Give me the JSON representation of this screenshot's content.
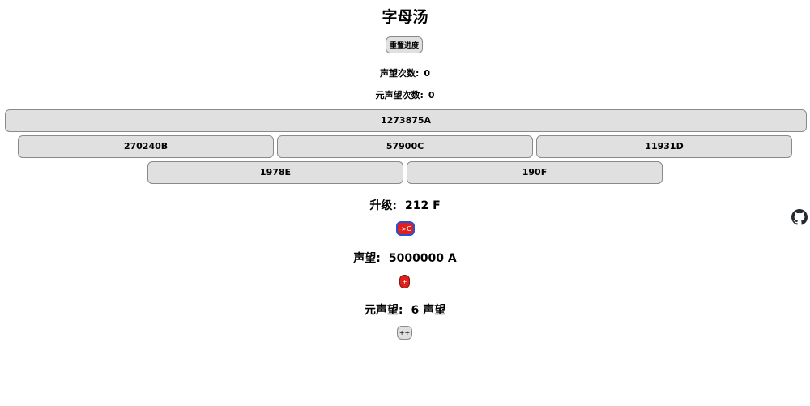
{
  "page": {
    "title": "字母汤"
  },
  "controls": {
    "reset_label": "重置进度"
  },
  "stats": {
    "prestige_count_label": "声望次数:",
    "prestige_count": "0",
    "meta_prestige_count_label": "元声望次数:",
    "meta_prestige_count": "0"
  },
  "generators": [
    {
      "label": "1273875A"
    },
    {
      "label": "270240B"
    },
    {
      "label": "57900C"
    },
    {
      "label": "11931D"
    },
    {
      "label": "1978E"
    },
    {
      "label": "190F"
    }
  ],
  "upgrade": {
    "label": "升级:",
    "value": "212 F",
    "button_label": "->G"
  },
  "prestige": {
    "label": "声望:",
    "value": "5000000 A",
    "button_label": "+"
  },
  "meta_prestige": {
    "label": "元声望:",
    "value": "6 声望",
    "button_label": "++"
  },
  "icons": {
    "github": "github-icon"
  },
  "colors": {
    "accent_red": "#e0201a",
    "accent_blue": "#2550d8",
    "button_gray": "#e0e0e0"
  }
}
